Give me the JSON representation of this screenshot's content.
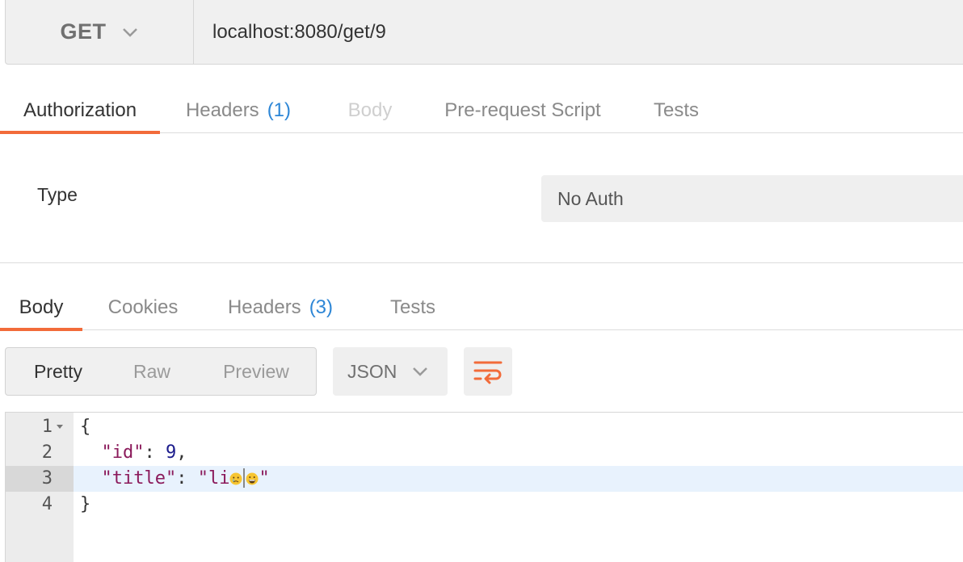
{
  "request": {
    "method": "GET",
    "url": "localhost:8080/get/9"
  },
  "request_tabs": [
    {
      "label": "Authorization",
      "state": "active"
    },
    {
      "label": "Headers",
      "count": "(1)",
      "state": "normal"
    },
    {
      "label": "Body",
      "state": "disabled"
    },
    {
      "label": "Pre-request Script",
      "state": "normal"
    },
    {
      "label": "Tests",
      "state": "normal"
    }
  ],
  "auth": {
    "type_label": "Type",
    "type_value": "No Auth"
  },
  "response_tabs": [
    {
      "label": "Body",
      "state": "active"
    },
    {
      "label": "Cookies",
      "state": "normal"
    },
    {
      "label": "Headers",
      "count": "(3)",
      "state": "normal"
    },
    {
      "label": "Tests",
      "state": "normal"
    }
  ],
  "view_modes": [
    "Pretty",
    "Raw",
    "Preview"
  ],
  "active_view": "Pretty",
  "format": "JSON",
  "icons": {
    "method_dropdown": "chevron-down-icon",
    "format_dropdown": "chevron-down-icon",
    "wrap": "wrap-lines-icon",
    "fold": "fold-caret-icon"
  },
  "colors": {
    "accent": "#f26b3a",
    "count": "#2d86d6",
    "json_key": "#8b1a5b",
    "json_number": "#1c1c8c",
    "highlight_line": "#e8f2fd"
  },
  "editor": {
    "line_numbers": [
      "1",
      "2",
      "3",
      "4"
    ],
    "lines": {
      "l1": "{",
      "l2_key": "\"id\"",
      "l2_sep": ": ",
      "l2_val": "9",
      "l2_tail": ",",
      "l3_key": "\"title\"",
      "l3_sep": ": ",
      "l3_val_prefix": "\"li",
      "l3_val_suffix": "\"",
      "l4": "}"
    },
    "emojis": [
      "crying-face-emoji",
      "grinning-face-emoji"
    ]
  }
}
